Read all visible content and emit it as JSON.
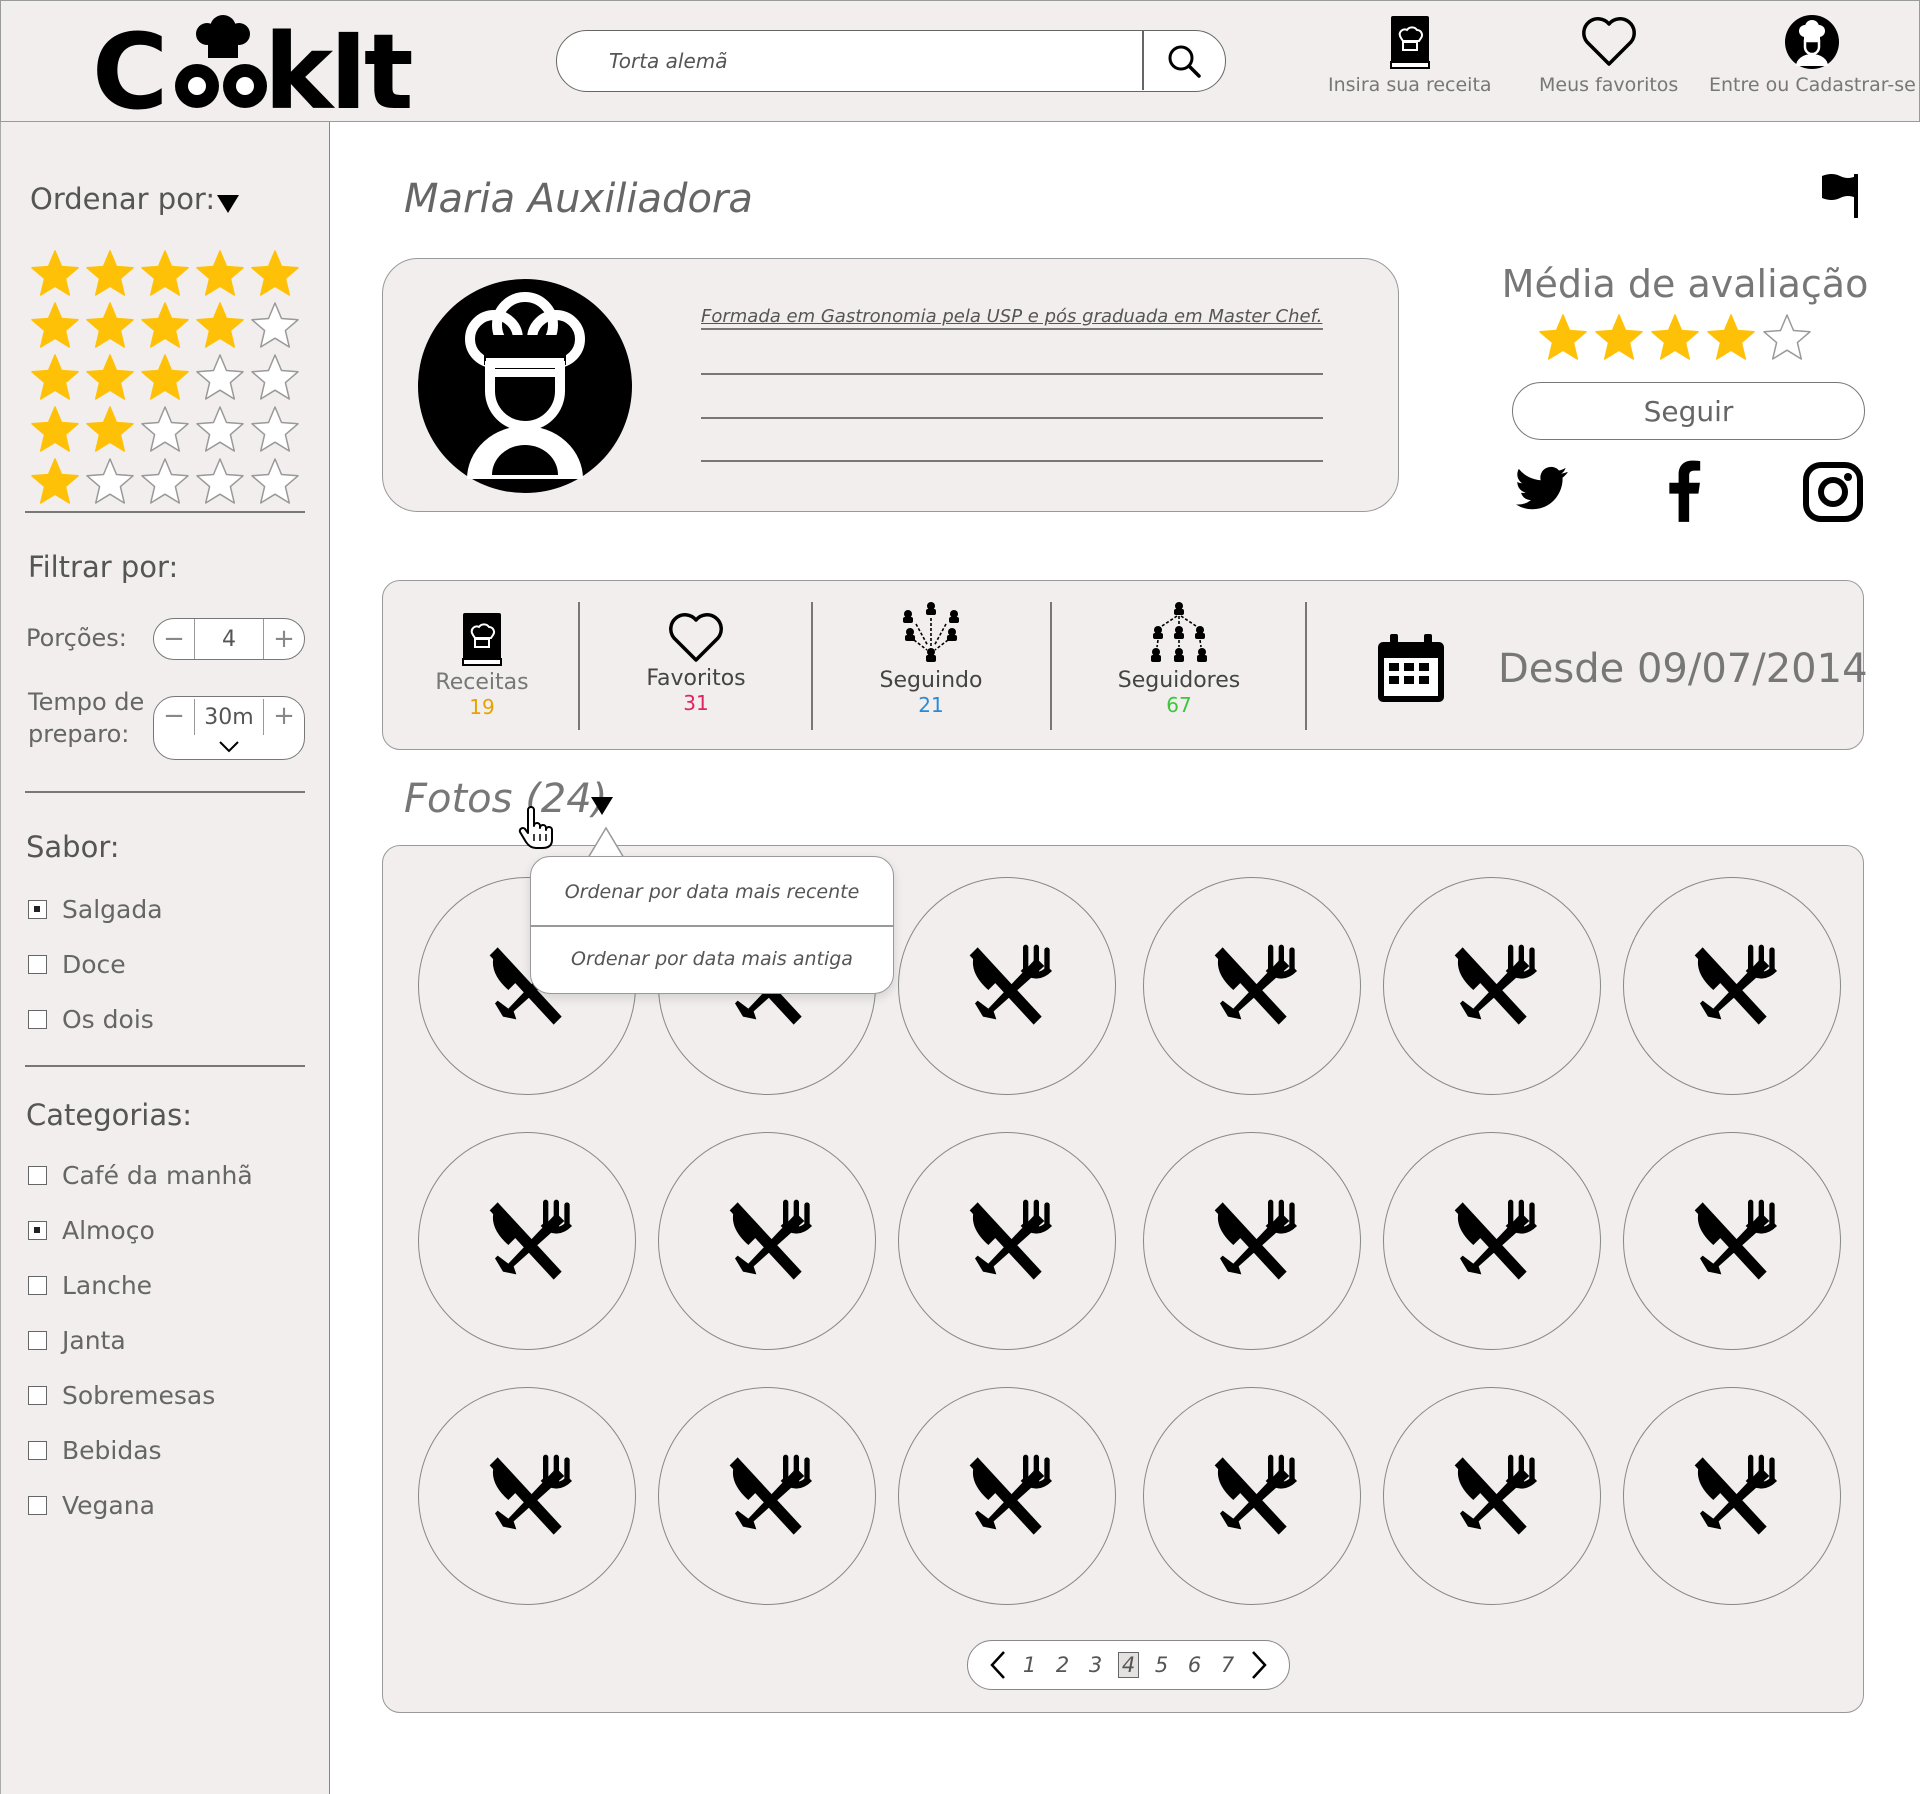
{
  "app": {
    "logo_text": "CookIt"
  },
  "header": {
    "search": {
      "value": "Torta alemã",
      "placeholder": "Torta alemã"
    },
    "nav": [
      {
        "label": "Insira sua receita",
        "icon": "recipe-book-icon"
      },
      {
        "label": "Meus favoritos",
        "icon": "heart-icon"
      },
      {
        "label": "Entre ou Cadastrar-se",
        "icon": "chef-avatar-icon"
      }
    ]
  },
  "sidebar": {
    "sort_label": "Ordenar por:",
    "star_filters": [
      5,
      4,
      3,
      2,
      1
    ],
    "filter_label": "Filtrar por:",
    "portions": {
      "label": "Porções:",
      "value": "4"
    },
    "prep_time": {
      "label_line1": "Tempo de",
      "label_line2": "preparo:",
      "value": "30m"
    },
    "flavor": {
      "title": "Sabor:",
      "options": [
        {
          "label": "Salgada",
          "checked": true
        },
        {
          "label": "Doce",
          "checked": false
        },
        {
          "label": "Os dois",
          "checked": false
        }
      ]
    },
    "categories": {
      "title": "Categorias:",
      "options": [
        {
          "label": "Café da manhã",
          "checked": false
        },
        {
          "label": "Almoço",
          "checked": true
        },
        {
          "label": "Lanche",
          "checked": false
        },
        {
          "label": "Janta",
          "checked": false
        },
        {
          "label": "Sobremesas",
          "checked": false
        },
        {
          "label": "Bebidas",
          "checked": false
        },
        {
          "label": "Vegana",
          "checked": false
        }
      ]
    }
  },
  "profile": {
    "name": "Maria Auxiliadora",
    "bio": "Formada em Gastronomia pela USP e pós graduada em Master Chef.",
    "rating_title": "Média de avaliação",
    "rating": 4,
    "rating_max": 5,
    "follow_label": "Seguir",
    "social": [
      "twitter-icon",
      "facebook-icon",
      "instagram-icon"
    ]
  },
  "stats": [
    {
      "label": "Receitas",
      "value": "19",
      "color": "#e8a200"
    },
    {
      "label": "Favoritos",
      "value": "31",
      "color": "#e0245e"
    },
    {
      "label": "Seguindo",
      "value": "21",
      "color": "#2b8ad6"
    },
    {
      "label": "Seguidores",
      "value": "67",
      "color": "#3cc73c"
    }
  ],
  "since": "Desde 09/07/2014",
  "photos": {
    "title": "Fotos (24)",
    "sort_menu": [
      "Ordenar por data mais recente",
      "Ordenar por data mais antiga"
    ],
    "visible_count": 18
  },
  "pagination": {
    "pages": [
      "1",
      "2",
      "3",
      "4",
      "5",
      "6",
      "7"
    ],
    "current": "4"
  },
  "colors": {
    "star": "#ffc107",
    "panel": "#f1eeed"
  }
}
